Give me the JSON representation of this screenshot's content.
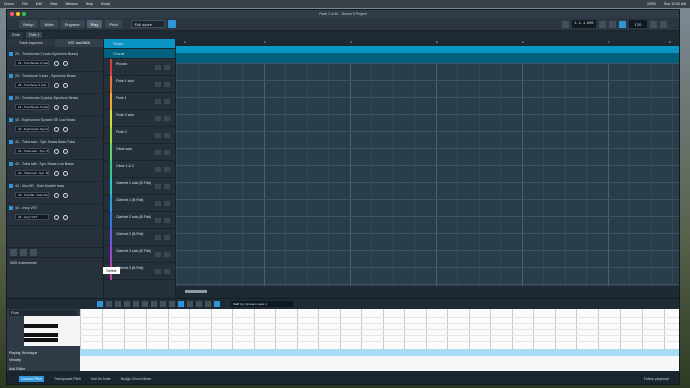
{
  "menubar": {
    "items": [
      "Dorico",
      "File",
      "Edit",
      "View",
      "Window",
      "Help",
      "Script"
    ],
    "right_items": [
      "100%",
      "Sun 12:00 AM"
    ]
  },
  "window": {
    "title": "Flute 1 in B♭ - Dorico 5 Project"
  },
  "toolbar": {
    "modes": [
      "Setup",
      "Write",
      "Engrave",
      "Play",
      "Print"
    ],
    "active_mode": "Play",
    "layout_select": "Full score",
    "timecode": "1.1.1.000",
    "tempo": "120"
  },
  "subtabs": {
    "items": [
      "Flute",
      "Flute 1"
    ]
  },
  "inspector": {
    "tabs": [
      "Track Inspector",
      "VST and MIDI"
    ],
    "active_tab": "VST and MIDI",
    "devices": [
      {
        "title": "23 - Trombones 2 (solo-Synchron Brass)",
        "control": "23 - Trombones 2 (solo)"
      },
      {
        "title": "25 - Trombone 3 solo - Synchron Brass",
        "control": "25 - Trombone 3 solo"
      },
      {
        "title": "24 - Trombones 3 (solo)-Synchron Brass",
        "control": "24 - Trombones 3 (solo)"
      },
      {
        "title": "40 - Euphonium Synced SE Low Brass",
        "control": "40 - Euphonium Synced"
      },
      {
        "title": "41 - Tuba solo - Syn. Brass Bass Tuba",
        "control": "41 - Tuba solo - Syn. Br."
      },
      {
        "title": "42 - Tuba tutti - Syn. Brass Low Brass",
        "control": "42 - Tuba tutti - Syn. Br."
      },
      {
        "title": "43 - Xtra 5E - Solo Double bass",
        "control": "43 - Xtra 5E - Solo Dou..."
      },
      {
        "title": "44 - Ivory VST",
        "control": "44 - Ivory VST"
      }
    ],
    "footer_label": "MIDI Instruments",
    "tooltip": "Delete"
  },
  "tracks": {
    "tempo_label": "Tempo",
    "chords_label": "Chords",
    "items": [
      {
        "name": "Piccolo",
        "color": "#d63f3f"
      },
      {
        "name": "Flute 1 solo",
        "color": "#e77735"
      },
      {
        "name": "Flute 1",
        "color": "#f1a735"
      },
      {
        "name": "Flute 2 solo",
        "color": "#d6d844"
      },
      {
        "name": "Flute 2",
        "color": "#98d64a"
      },
      {
        "name": "Oboe solo",
        "color": "#58d65f"
      },
      {
        "name": "Oboe 1 & 2",
        "color": "#37c98f"
      },
      {
        "name": "Clarinet 1 solo (B Flat)",
        "color": "#2bc3c7"
      },
      {
        "name": "Clarinet 1 (B Flat)",
        "color": "#2d9ee0"
      },
      {
        "name": "Clarinet 2 solo (B Flat)",
        "color": "#3678e7"
      },
      {
        "name": "Clarinet 2 (B Flat)",
        "color": "#6f58e2"
      },
      {
        "name": "Clarinet 3 solo (B Flat)",
        "color": "#a045d7"
      },
      {
        "name": "Clarinet 3 (B Flat)",
        "color": "#cc3cab"
      }
    ]
  },
  "timeline": {
    "measures": [
      "2",
      "3",
      "4",
      "5",
      "6",
      "7",
      "8"
    ]
  },
  "lower_toolbar": {
    "voice": "Staff (u), Up-stem voice 1"
  },
  "editor": {
    "track": "Flute",
    "playing_technique": "Playing Technique",
    "velocity": "Velocity",
    "add_editor": "Add Editor"
  },
  "status": {
    "items": [
      "Concert Pitch",
      "Transposed Pitch",
      "Not On Note",
      "Nudge Chord Mode",
      "Follow playhead"
    ],
    "active_index": 0
  },
  "colors": {
    "accent": "#2f95d6",
    "tempo_lane": "#0a96c5",
    "chord_lane": "#00617f",
    "timeline_bg": "#2a3d4b"
  }
}
